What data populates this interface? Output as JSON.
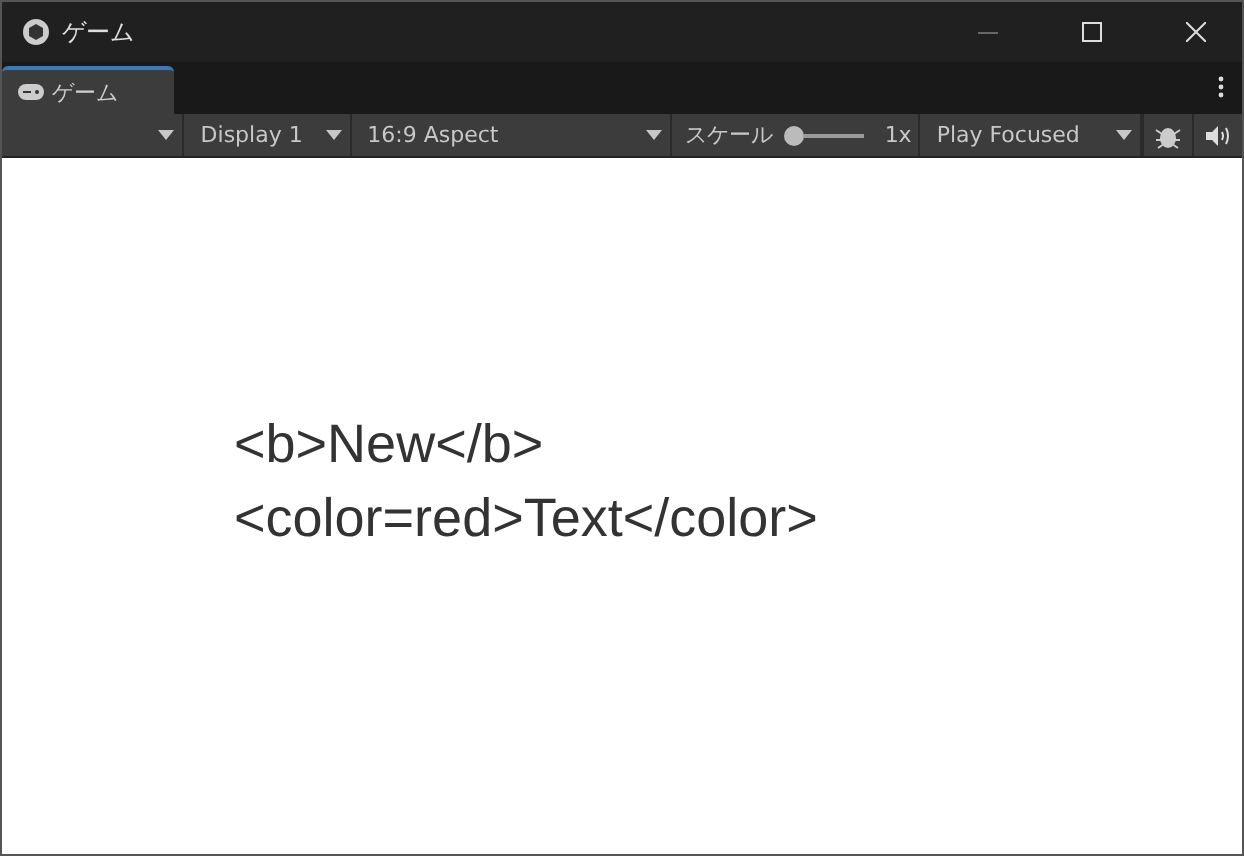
{
  "window": {
    "title": "ゲーム"
  },
  "tabs": [
    {
      "label": "ゲーム",
      "selected": true
    }
  ],
  "toolbar": {
    "display": "Display 1",
    "aspect": "16:9 Aspect",
    "scale_label": "スケール",
    "scale": {
      "level": 0
    },
    "scale_reading": "1x",
    "play_mode": "Play Focused"
  },
  "game_view": {
    "lines": [
      "<b>New</b>",
      "<color=red>Text</color>"
    ]
  }
}
